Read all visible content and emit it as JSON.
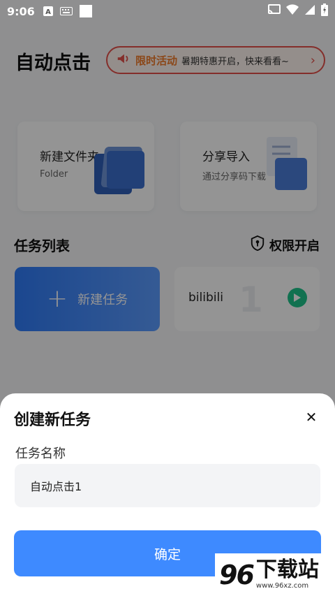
{
  "status_bar": {
    "time": "9:06"
  },
  "header": {
    "title": "自动点击",
    "promo_badge": "限时活动",
    "promo_text": "暑期特惠开启，快来看看~"
  },
  "cards": [
    {
      "title": "新建文件夹",
      "subtitle": "Folder"
    },
    {
      "title": "分享导入",
      "subtitle": "通过分享码下载"
    }
  ],
  "tasks": {
    "section_title": "任务列表",
    "permission_label": "权限开启",
    "new_task_label": "新建任务",
    "items": [
      {
        "name": "bilibili",
        "number": "1"
      }
    ]
  },
  "dialog": {
    "title": "创建新任务",
    "field_label": "任务名称",
    "field_value": "自动点击1",
    "confirm_label": "确定"
  },
  "watermark": {
    "logo": "96",
    "text": "下载站",
    "url": "www.96xz.com"
  },
  "colors": {
    "accent": "#3e8aff",
    "promo_border": "#e4504a",
    "play": "#1ec38a"
  }
}
